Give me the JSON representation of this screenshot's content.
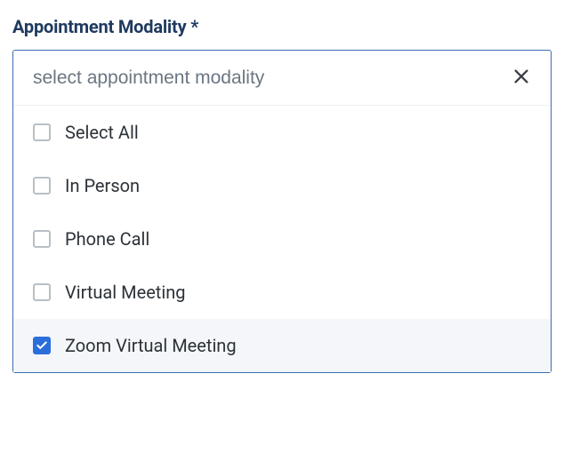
{
  "field": {
    "label": "Appointment Modality *"
  },
  "search": {
    "placeholder": "select appointment modality",
    "value": ""
  },
  "options": [
    {
      "label": "Select All",
      "checked": false
    },
    {
      "label": "In Person",
      "checked": false
    },
    {
      "label": "Phone Call",
      "checked": false
    },
    {
      "label": "Virtual Meeting",
      "checked": false
    },
    {
      "label": "Zoom Virtual Meeting",
      "checked": true
    }
  ]
}
